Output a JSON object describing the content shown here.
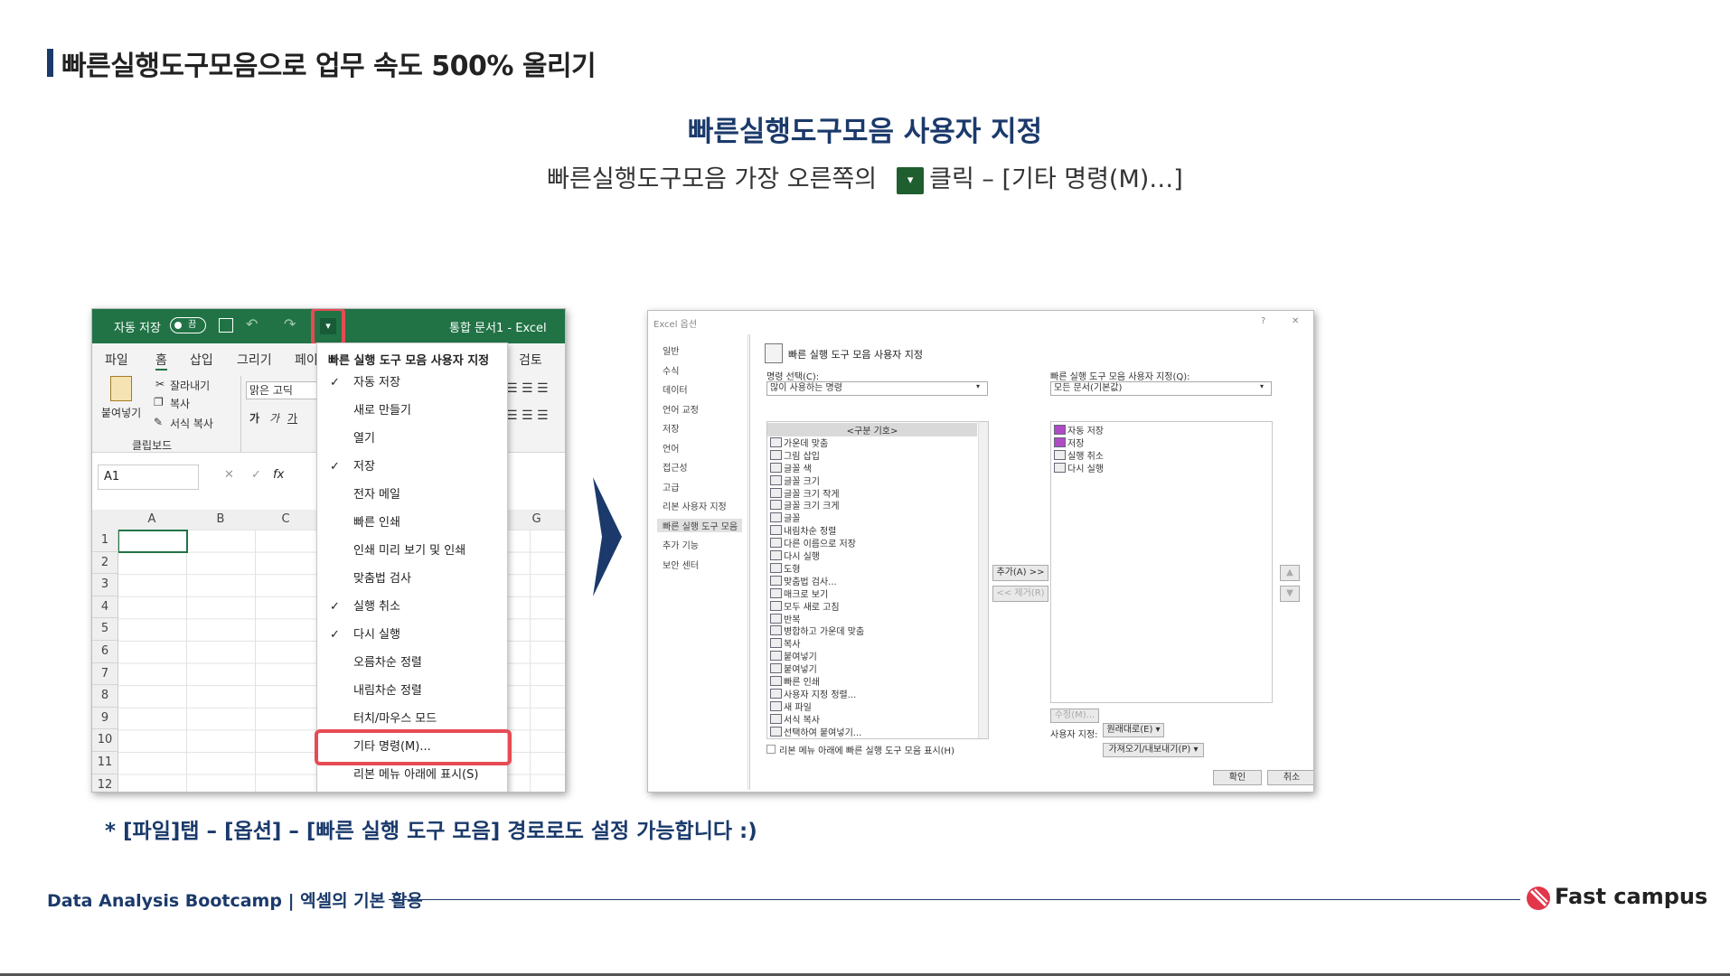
{
  "header": {
    "page_title": "빠른실행도구모음으로 업무 속도 500% 올리기",
    "center_title": "빠른실행도구모음 사용자 지정",
    "center_sub_before": "빠른실행도구모음 가장 오른쪽의",
    "center_sub_after": "클릭 – [기타 명령(M)…]",
    "inline_icon": "dropdown-caret-icon"
  },
  "excel": {
    "autosave_label": "자동 저장",
    "autosave_toggle": "끔",
    "window_title": "통합 문서1  -  Excel",
    "menu_tabs": [
      "파일",
      "홈",
      "삽입",
      "그리기",
      "페이",
      "검토"
    ],
    "ribbon": {
      "paste": "붙여넣기",
      "cut": "잘라내기",
      "copy": "복사",
      "format_painter": "서식 복사",
      "group_clipboard": "클립보드",
      "font_name": "맑은 고딕",
      "bold": "가",
      "italic": "가",
      "underline": "가"
    },
    "name_box": "A1",
    "formula_fx": "fx",
    "columns": [
      "A",
      "B",
      "C",
      "G"
    ],
    "rows": [
      "1",
      "2",
      "3",
      "4",
      "5",
      "6",
      "7",
      "8",
      "9",
      "10",
      "11",
      "12"
    ],
    "dropdown": {
      "header": "빠른 실행 도구 모음 사용자 지정",
      "items": [
        {
          "label": "자동 저장",
          "checked": "✓"
        },
        {
          "label": "새로 만들기",
          "checked": ""
        },
        {
          "label": "열기",
          "checked": ""
        },
        {
          "label": "저장",
          "checked": "✓"
        },
        {
          "label": "전자 메일",
          "checked": ""
        },
        {
          "label": "빠른 인쇄",
          "checked": ""
        },
        {
          "label": "인쇄 미리 보기 및 인쇄",
          "checked": ""
        },
        {
          "label": "맞춤법 검사",
          "checked": ""
        },
        {
          "label": "실행 취소",
          "checked": "✓"
        },
        {
          "label": "다시 실행",
          "checked": "✓"
        },
        {
          "label": "오름차순 정렬",
          "checked": ""
        },
        {
          "label": "내림차순 정렬",
          "checked": ""
        },
        {
          "label": "터치/마우스 모드",
          "checked": ""
        },
        {
          "label": "기타 명령(M)...",
          "checked": ""
        },
        {
          "label": "리본 메뉴 아래에 표시(S)",
          "checked": ""
        }
      ]
    }
  },
  "dialog": {
    "title": "Excel 옵션",
    "help": "?",
    "close": "✕",
    "sidebar": [
      "일반",
      "수식",
      "데이터",
      "언어 교정",
      "저장",
      "언어",
      "접근성",
      "고급",
      "리본 사용자 지정",
      "빠른 실행 도구 모음",
      "추가 기능",
      "보안 센터"
    ],
    "section_title": "빠른 실행 도구 모음 사용자 지정",
    "choose_label": "명령 선택(C):",
    "choose_value": "많이 사용하는 명령",
    "customize_label": "빠른 실행 도구 모음 사용자 지정(Q):",
    "customize_value": "모든 문서(기본값)",
    "commands": [
      "<구분 기호>",
      "가운데 맞춤",
      "그림 삽입",
      "글꼴 색",
      "글꼴 크기",
      "글꼴 크기 작게",
      "글꼴 크기 크게",
      "글꼴",
      "내림차순 정렬",
      "다른 이름으로 저장",
      "다시 실행",
      "도형",
      "맞춤법 검사...",
      "매크로 보기",
      "모두 새로 고침",
      "반복",
      "병합하고 가운데 맞춤",
      "복사",
      "붙여넣기",
      "붙여넣기",
      "빠른 인쇄",
      "사용자 지정 정렬...",
      "새 파일",
      "서식 복사",
      "선택하여 붙여넣기..."
    ],
    "qat_items": [
      "자동 저장",
      "저장",
      "실행 취소",
      "다시 실행"
    ],
    "add_button": "추가(A) >>",
    "remove_button": "<< 제거(R)",
    "modify_button": "수정(M)...",
    "show_below_checkbox": "리본 메뉴 아래에 빠른 실행 도구 모음 표시(H)",
    "custom_label": "사용자 지정:",
    "reset_button": "원래대로(E) ▾",
    "import_export_button": "가져오기/내보내기(P) ▾",
    "ok_button": "확인",
    "cancel_button": "취소"
  },
  "footer": {
    "footnote": "* [파일]탭 – [옵션] – [빠른 실행 도구 모음] 경로로도 설정 가능합니다 :)",
    "course": "Data Analysis Bootcamp | 엑셀의 기본 활용",
    "brand": "Fast campus"
  },
  "colors": {
    "navy": "#1b3a6b",
    "excel_green": "#217346",
    "highlight_red": "#e64b54"
  }
}
